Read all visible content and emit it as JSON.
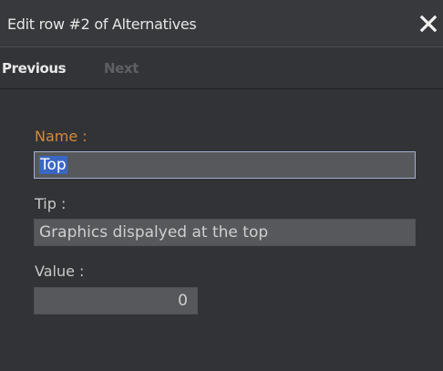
{
  "window": {
    "title": "Edit row #2 of Alternatives",
    "close_icon": "close-icon"
  },
  "nav": {
    "previous_label": "Previous",
    "next_label": "Next"
  },
  "form": {
    "name_label": "Name :",
    "name_value": "Top",
    "tip_label": "Tip :",
    "tip_value": "Graphics dispalyed at the top",
    "value_label": "Value :",
    "value_value": "0"
  },
  "colors": {
    "active_label": "#d08a3c",
    "selection": "#3b67c4",
    "disabled_nav": "#5f6064"
  }
}
